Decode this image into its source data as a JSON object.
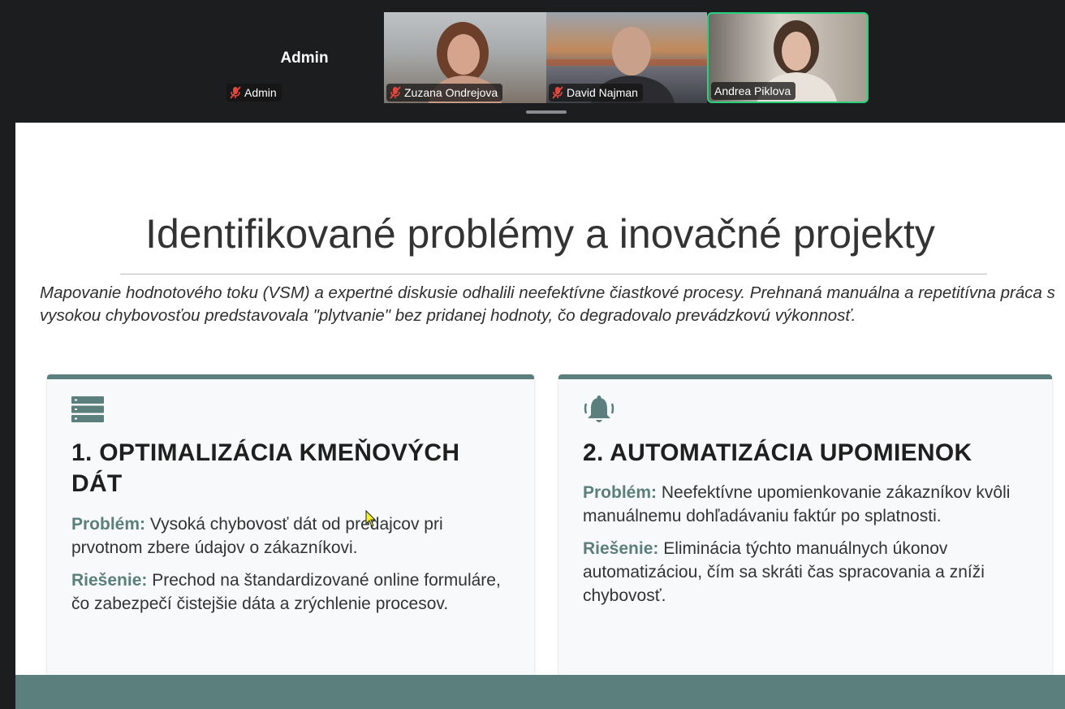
{
  "participants": {
    "admin": {
      "display_name": "Admin",
      "label": "Admin",
      "mic": "muted"
    },
    "zuzana": {
      "label": "Zuzana Ondrejova",
      "mic": "muted"
    },
    "david": {
      "label": "David Najman",
      "mic": "muted"
    },
    "andrea": {
      "label": "Andrea Piklova",
      "mic": "active",
      "highlight_color": "#27d27a"
    }
  },
  "slide": {
    "title": "Identifikované problémy a inovačné projekty",
    "intro": "Mapovanie hodnotového toku (VSM) a expertné diskusie odhalili neefektívne čiastkové procesy. Prehnaná manuálna a repetitívna práca s vysokou chybovosťou predstavovala \"plytvanie\" bez pridanej hodnoty, čo degradovalo prevádzkovú výkonnosť.",
    "accent_color": "#5b7f7c",
    "cards": [
      {
        "icon": "database-list-icon",
        "heading": "1. OPTIMALIZÁCIA KMEŇOVÝCH DÁT",
        "problem_label": "Problém:",
        "problem_text": " Vysoká chybovosť dát od predajcov pri prvotnom zbere údajov o zákazníkovi.",
        "solution_label": "Riešenie:",
        "solution_text": " Prechod na štandardizované online formuláre, čo zabezpečí čistejšie dáta a zrýchlenie procesov."
      },
      {
        "icon": "bell-ringing-icon",
        "heading": "2. AUTOMATIZÁCIA UPOMIENOK",
        "problem_label": "Problém:",
        "problem_text": " Neefektívne upomienkovanie zákazníkov kvôli manuálnemu dohľadávaniu faktúr po splatnosti.",
        "solution_label": "Riešenie:",
        "solution_text": " Eliminácia týchto manuálnych úkonov automatizáciou, čím sa skráti čas spracovania a zníži chybovosť."
      }
    ]
  }
}
